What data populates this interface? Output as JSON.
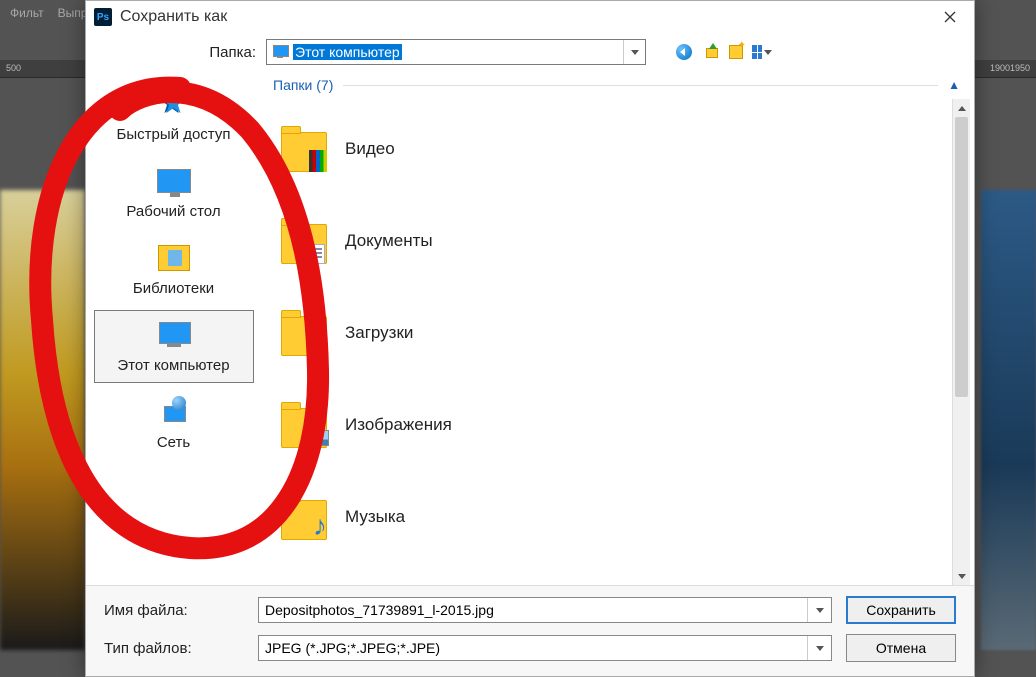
{
  "ps_menu": {
    "item1": "Фильт",
    "item2": "Выпря"
  },
  "ruler_left": [
    "500"
  ],
  "ruler_right": [
    "1900",
    "1950"
  ],
  "dialog": {
    "title": "Сохранить как",
    "folder_label": "Папка:",
    "folder_value": "Этот компьютер"
  },
  "places": [
    {
      "id": "quick",
      "label": "Быстрый доступ",
      "selected": false
    },
    {
      "id": "desktop",
      "label": "Рабочий стол",
      "selected": false
    },
    {
      "id": "libs",
      "label": "Библиотеки",
      "selected": false
    },
    {
      "id": "thispc",
      "label": "Этот компьютер",
      "selected": true
    },
    {
      "id": "network",
      "label": "Сеть",
      "selected": false
    }
  ],
  "group": {
    "title": "Папки (7)"
  },
  "folders": [
    {
      "label": "Видео",
      "overlay": "vid"
    },
    {
      "label": "Документы",
      "overlay": "doc"
    },
    {
      "label": "Загрузки",
      "overlay": "dl"
    },
    {
      "label": "Изображения",
      "overlay": "img"
    },
    {
      "label": "Музыка",
      "overlay": "mus"
    }
  ],
  "filename_label": "Имя файла:",
  "filename_value": "Depositphotos_71739891_l-2015.jpg",
  "filetype_label": "Тип файлов:",
  "filetype_value": "JPEG (*.JPG;*.JPEG;*.JPE)",
  "save_button": "Сохранить",
  "cancel_button": "Отмена"
}
